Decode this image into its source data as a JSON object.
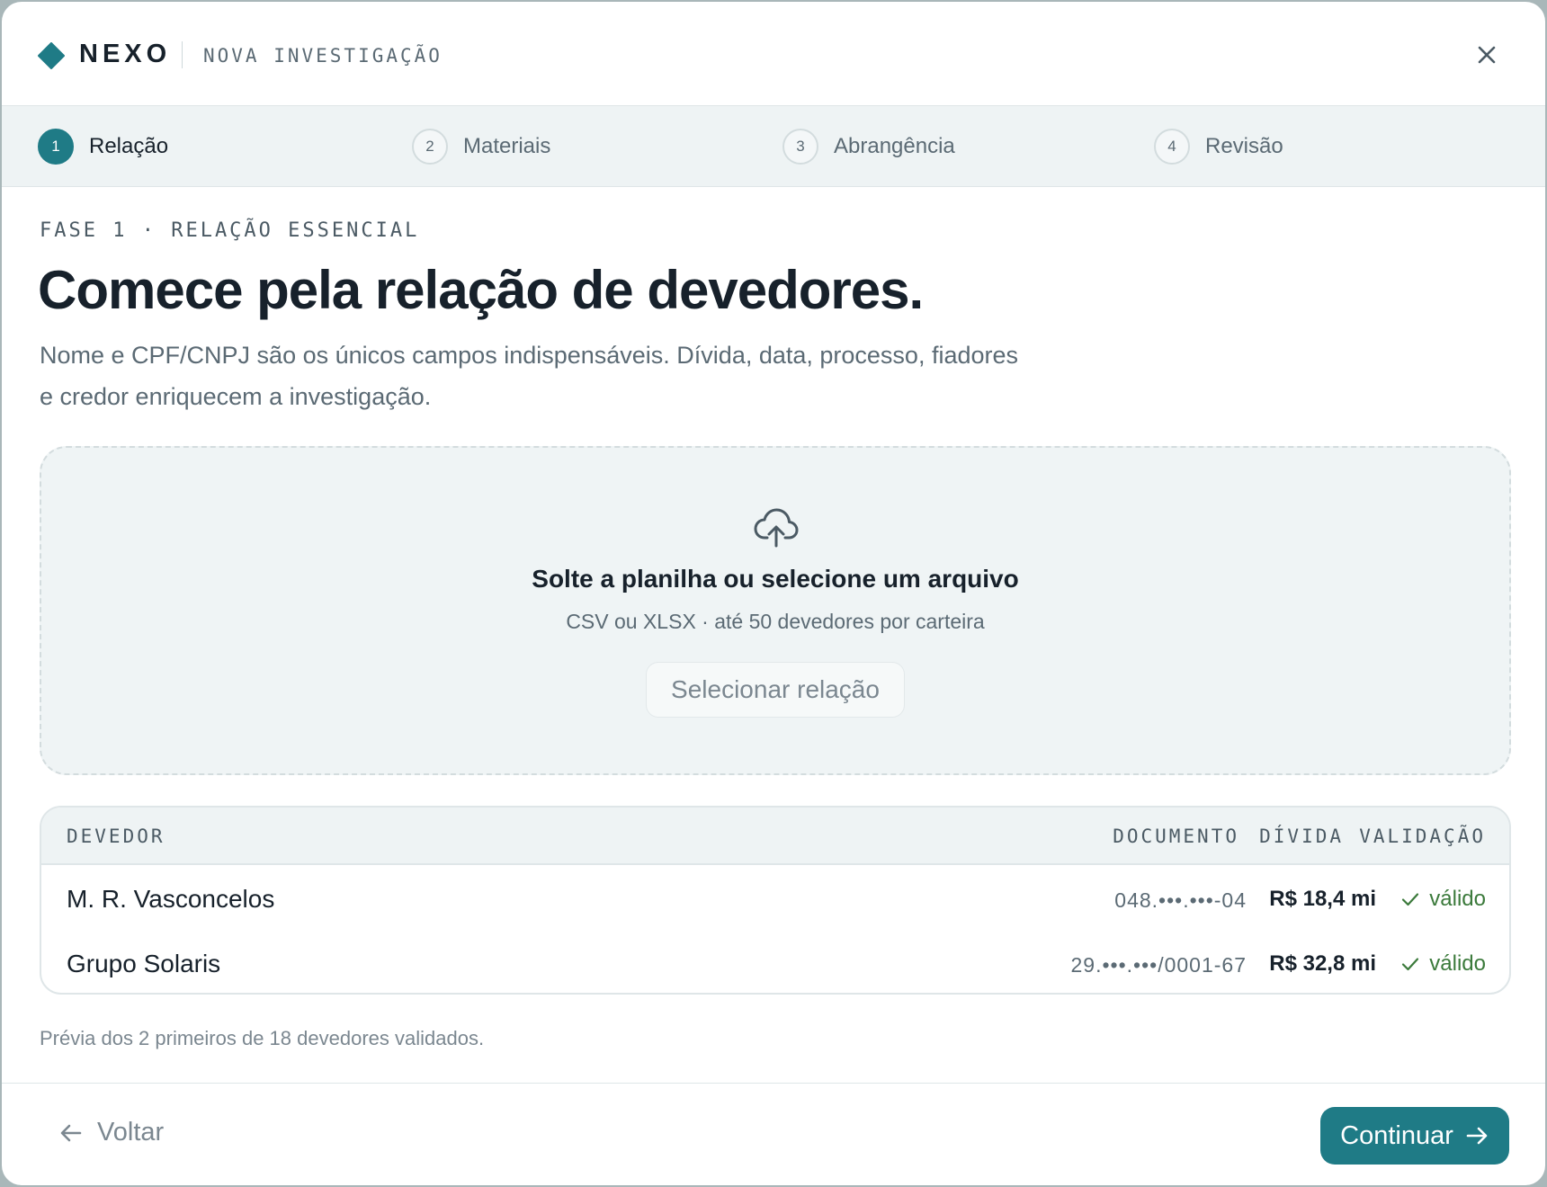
{
  "header": {
    "brand": "NEXO",
    "subtitle": "NOVA INVESTIGAÇÃO"
  },
  "stepper": {
    "steps": [
      {
        "number": "1",
        "label": "Relação",
        "active": true
      },
      {
        "number": "2",
        "label": "Materiais",
        "active": false
      },
      {
        "number": "3",
        "label": "Abrangência",
        "active": false
      },
      {
        "number": "4",
        "label": "Revisão",
        "active": false
      }
    ]
  },
  "main": {
    "eyebrow": "FASE 1 · RELAÇÃO ESSENCIAL",
    "title": "Comece pela relação de devedores.",
    "description_line1": "Nome e CPF/CNPJ são os únicos campos indispensáveis. Dívida, data, processo, fiadores",
    "description_line2": "e credor enriquecem a investigação."
  },
  "dropzone": {
    "icon": "cloud-upload-icon",
    "title": "Solte a planilha ou selecione um arquivo",
    "subtitle": "CSV ou XLSX · até 50 devedores por carteira",
    "button_label": "Selecionar relação"
  },
  "table": {
    "headers": {
      "debtor": "DEVEDOR",
      "document": "DOCUMENTO",
      "debt": "DÍVIDA",
      "validation": "VALIDAÇÃO"
    },
    "rows": [
      {
        "name": "M. R. Vasconcelos",
        "document": "048.•••.•••-04",
        "debt": "R$ 18,4 mi",
        "status": "válido"
      },
      {
        "name": "Grupo Solaris",
        "document": "29.•••.•••/0001-67",
        "debt": "R$ 32,8 mi",
        "status": "válido"
      }
    ]
  },
  "footnote": "Prévia dos 2 primeiros de 18 devedores validados.",
  "footer": {
    "back_label": "Voltar",
    "next_label": "Continuar"
  },
  "colors": {
    "accent": "#1f7b86",
    "valid": "#3b7a3b"
  }
}
